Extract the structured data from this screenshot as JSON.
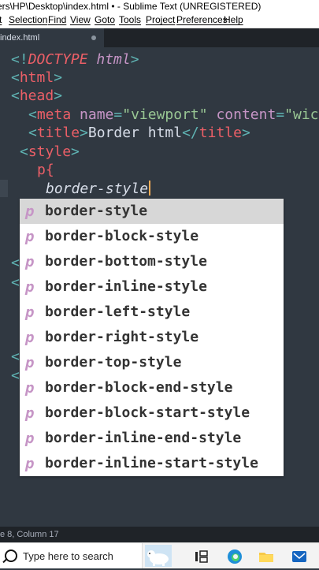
{
  "window": {
    "title": "ers\\HP\\Desktop\\index.html • - Sublime Text (UNREGISTERED)"
  },
  "menu": [
    "t",
    "Selection",
    "Find",
    "View",
    "Goto",
    "Tools",
    "Project",
    "Preferences",
    "Help"
  ],
  "tab": {
    "label": "index.html"
  },
  "code": {
    "l1_a": "<!",
    "l1_b": "DOCTYPE",
    "l1_c": " html",
    "l1_d": ">",
    "l2_a": "<",
    "l2_b": "html",
    "l2_c": ">",
    "l3_a": "<",
    "l3_b": "head",
    "l3_c": ">",
    "l4_a": "<",
    "l4_b": "meta",
    "l4_c": " name",
    "l4_d": "=",
    "l4_e": "\"viewport\"",
    "l4_f": " content",
    "l4_g": "=",
    "l4_h": "\"wic",
    "l5_a": "<",
    "l5_b": "title",
    "l5_c": ">",
    "l5_d": "Border html",
    "l5_e": "</",
    "l5_f": "title",
    "l5_g": ">",
    "l6_a": "<",
    "l6_b": "style",
    "l6_c": ">",
    "l7": "p{",
    "l8": "border-style"
  },
  "autocomplete": {
    "kind": "p",
    "items": [
      {
        "a": "border-",
        "b": "style",
        "c": ""
      },
      {
        "a": "border-block-",
        "b": "style",
        "c": ""
      },
      {
        "a": "border-bottom-",
        "b": "style",
        "c": ""
      },
      {
        "a": "border-inline-",
        "b": "style",
        "c": ""
      },
      {
        "a": "border-left-",
        "b": "style",
        "c": ""
      },
      {
        "a": "border-right-",
        "b": "style",
        "c": ""
      },
      {
        "a": "border-top-",
        "b": "style",
        "c": ""
      },
      {
        "a": "border-block-end-",
        "b": "style",
        "c": ""
      },
      {
        "a": "border-block-start-",
        "b": "style",
        "c": ""
      },
      {
        "a": "border-inline-end-",
        "b": "style",
        "c": ""
      },
      {
        "a": "border-inline-start-",
        "b": "style",
        "c": ""
      }
    ]
  },
  "status": {
    "position": "e 8, Column 17"
  },
  "taskbar": {
    "search_placeholder": "Type here to search"
  },
  "colors": {
    "editor_bg": "#303841",
    "tag": "#ec5f67",
    "bracket": "#5fb3b3",
    "attr": "#c695c6",
    "string": "#99c794",
    "cursor": "#f9ae58"
  }
}
